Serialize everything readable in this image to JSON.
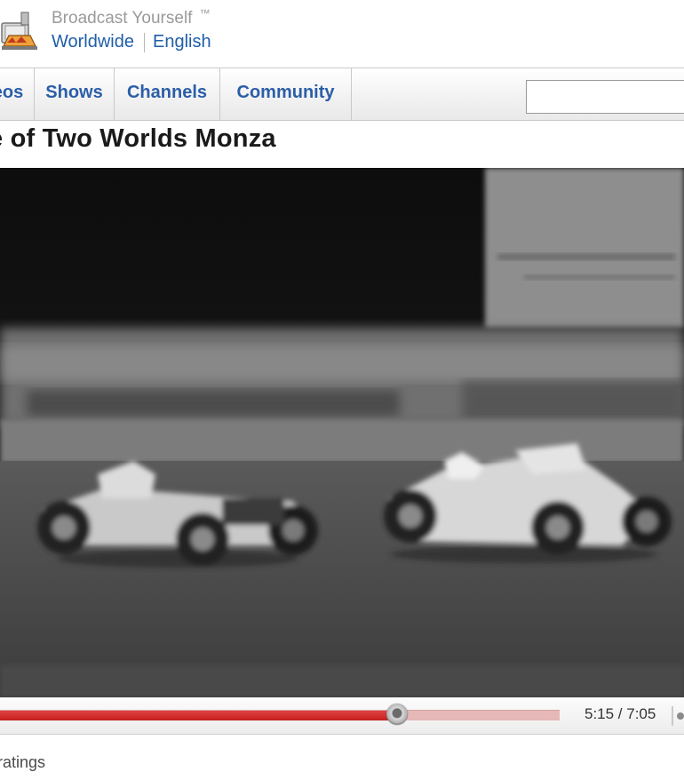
{
  "header": {
    "tagline": "Broadcast Yourself",
    "tagline_mark": "™",
    "region": "Worldwide",
    "language": "English"
  },
  "nav": {
    "tabs": [
      {
        "label": "eos"
      },
      {
        "label": "Shows"
      },
      {
        "label": "Channels"
      },
      {
        "label": "Community"
      }
    ],
    "search": {
      "value": "",
      "placeholder": ""
    }
  },
  "video": {
    "title": "e of Two Worlds Monza",
    "current_time": "5:15",
    "duration": "7:05",
    "time_display": "5:15 / 7:05",
    "progress_fraction": 0.71,
    "colors": {
      "played": "#d32f2f",
      "buffered": "#e6b8b8"
    }
  },
  "ratings": {
    "text": "ratings"
  },
  "icons": [
    "logo-icon",
    "scrubber-knob-icon",
    "volume-icon"
  ]
}
